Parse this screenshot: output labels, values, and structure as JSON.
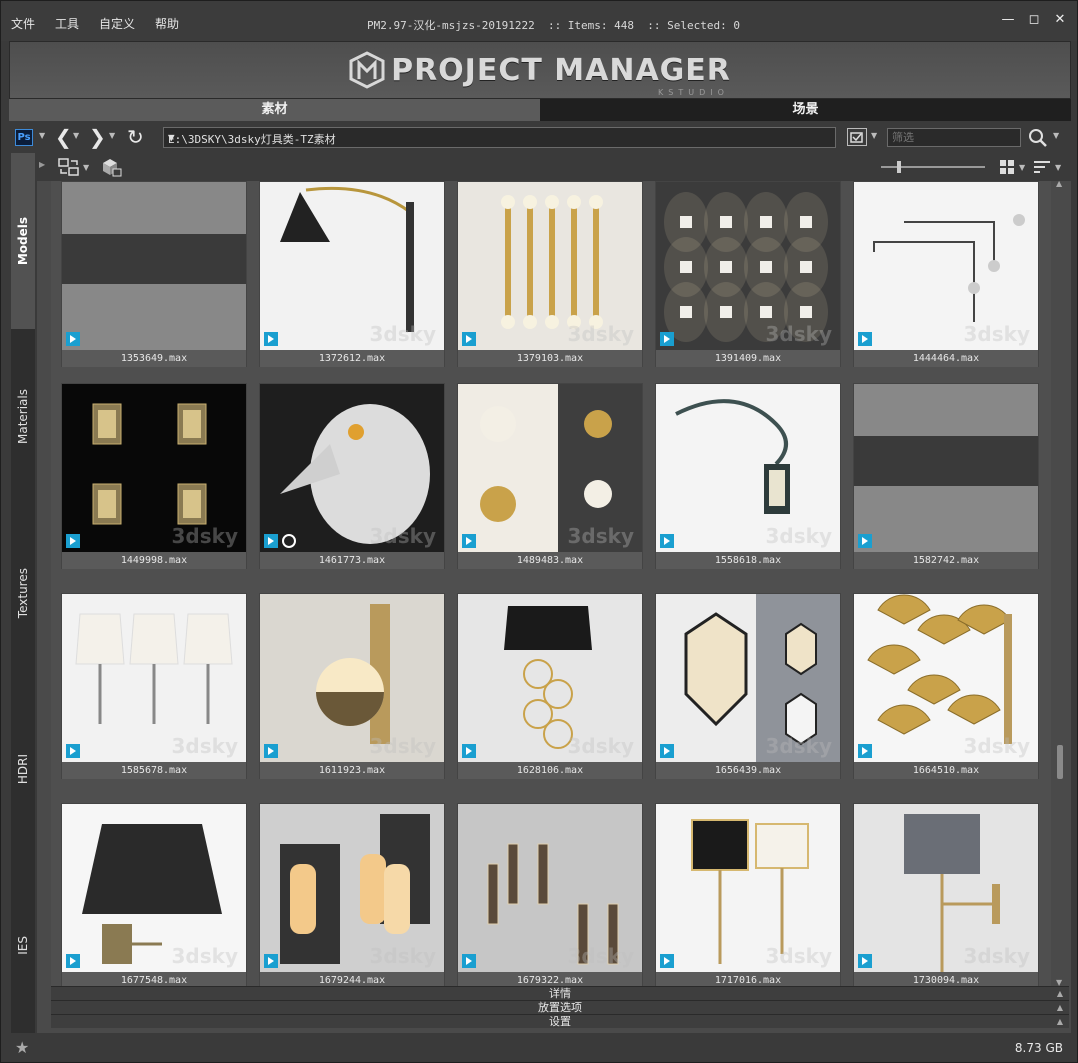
{
  "menu": [
    "文件",
    "工具",
    "自定义",
    "帮助"
  ],
  "window_title": "PM2.97-汉化-msjzs-20191222  :: Items: 448  :: Selected: 0",
  "window_controls": [
    "minimize-icon",
    "maximize-icon",
    "close-icon"
  ],
  "banner": {
    "logo": "PROJECT MANAGER",
    "sub": "KSTUDIO"
  },
  "tabs": [
    {
      "label": "素材",
      "active": true
    },
    {
      "label": "场景",
      "active": false
    }
  ],
  "toolbar": {
    "ps_label": "Ps",
    "path": "E:\\3DSKY\\3dsky灯具类-TZ素材",
    "filter_placeholder": "筛选"
  },
  "side_tabs": [
    {
      "label": "Models",
      "active": true
    },
    {
      "label": "Materials",
      "active": false
    },
    {
      "label": "Textures",
      "active": false
    },
    {
      "label": "HDRI",
      "active": false
    },
    {
      "label": "IES",
      "active": false
    }
  ],
  "items": [
    {
      "name": "1353649.max",
      "bg": "#888888",
      "kind": "placeholder"
    },
    {
      "name": "1372612.max",
      "bg": "#f2f2f2",
      "kind": "black-lamp"
    },
    {
      "name": "1379103.max",
      "bg": "#e9e6e0",
      "kind": "gold-tubes"
    },
    {
      "name": "1391409.max",
      "bg": "#3b3b3b",
      "kind": "wall-lights"
    },
    {
      "name": "1444464.max",
      "bg": "#f4f4f4",
      "kind": "pendant"
    },
    {
      "name": "1449998.max",
      "bg": "#080808",
      "kind": "lanterns"
    },
    {
      "name": "1461773.max",
      "bg": "#1e1e1e",
      "kind": "bird"
    },
    {
      "name": "1489483.max",
      "bg": "#f0ece4",
      "kind": "globes"
    },
    {
      "name": "1558618.max",
      "bg": "#f4f4f4",
      "kind": "street-lantern"
    },
    {
      "name": "1582742.max",
      "bg": "#888888",
      "kind": "placeholder"
    },
    {
      "name": "1585678.max",
      "bg": "#f2f2f2",
      "kind": "shades"
    },
    {
      "name": "1611923.max",
      "bg": "#dad7d0",
      "kind": "globe-plate"
    },
    {
      "name": "1628106.max",
      "bg": "#e6e6e6",
      "kind": "black-shade-rings"
    },
    {
      "name": "1656439.max",
      "bg": "#ededed",
      "kind": "hex-lamps"
    },
    {
      "name": "1664510.max",
      "bg": "#f6f6f6",
      "kind": "ginkgo"
    },
    {
      "name": "1677548.max",
      "bg": "#f6f6f6",
      "kind": "pleated-shade"
    },
    {
      "name": "1679244.max",
      "bg": "#cfcfcf",
      "kind": "candles"
    },
    {
      "name": "1679322.max",
      "bg": "#c6c6c6",
      "kind": "crystal"
    },
    {
      "name": "1717016.max",
      "bg": "#f4f4f4",
      "kind": "drum-shades"
    },
    {
      "name": "1730094.max",
      "bg": "#e4e4e4",
      "kind": "grey-drum"
    }
  ],
  "watermark": "3dsky",
  "bottom_panels": [
    "详情",
    "放置选项",
    "设置"
  ],
  "status": {
    "disk": "8.73 GB"
  },
  "colors": {
    "accent": "#1a9fd0",
    "active_tab": "#5b5b5b"
  }
}
